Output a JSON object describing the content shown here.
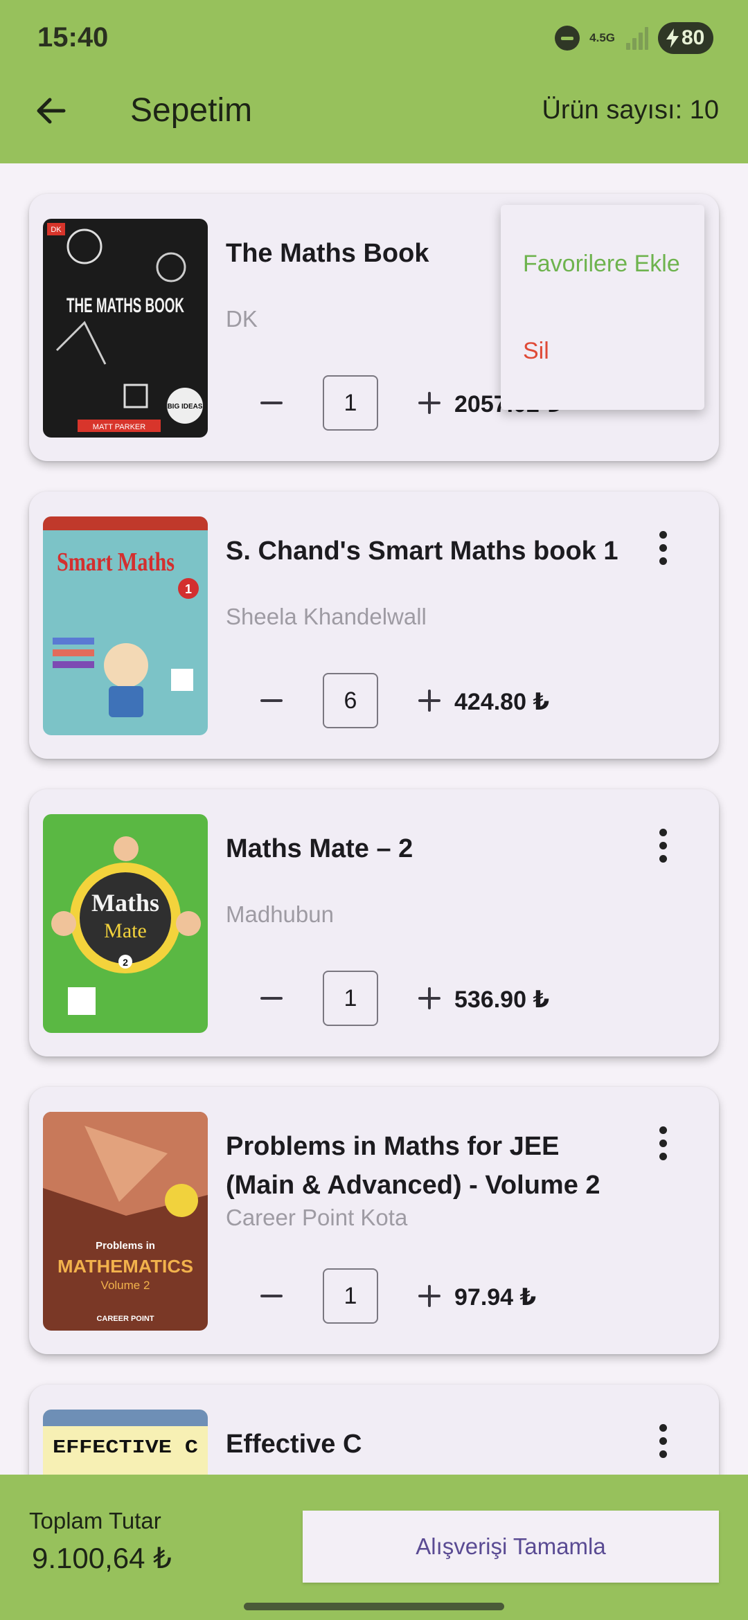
{
  "status_bar": {
    "time": "15:40",
    "network": "4.5G",
    "battery": "80"
  },
  "header": {
    "title": "Sepetim",
    "item_count": "Ürün sayısı: 10"
  },
  "items": [
    {
      "title": "The Maths Book",
      "author": "DK",
      "quantity": "1",
      "price": "2057.02 ₺",
      "cover_words": [
        "THE MATHS BOOK",
        "DK",
        "MATT PARKER",
        "BIG IDEAS"
      ]
    },
    {
      "title": "S. Chand's Smart Maths book 1",
      "author": "Sheela Khandelwall",
      "quantity": "6",
      "price": "424.80 ₺",
      "cover_words": [
        "Smart Maths",
        "1"
      ]
    },
    {
      "title": "Maths Mate – 2",
      "author": "Madhubun",
      "quantity": "1",
      "price": "536.90 ₺",
      "cover_words": [
        "Maths",
        "Mate",
        "2"
      ]
    },
    {
      "title": "Problems in Maths for JEE (Main & Advanced) - Volume 2",
      "author": "Career Point Kota",
      "quantity": "1",
      "price": "97.94 ₺",
      "cover_words": [
        "Problems in",
        "MATHEMATICS",
        "Volume 2",
        "CAREER POINT"
      ]
    },
    {
      "title": "Effective C",
      "author": "",
      "quantity": "",
      "price": "",
      "cover_words": [
        "EFFECTIVE C"
      ]
    }
  ],
  "popup_menu": {
    "add_favorite": "Favorilere Ekle",
    "delete": "Sil"
  },
  "footer": {
    "total_label": "Toplam Tutar",
    "total_value": "9.100,64 ₺",
    "checkout_label": "Alışverişi Tamamla"
  },
  "colors": {
    "app_bar": "#97c15c",
    "favorite": "#6eb34e",
    "delete": "#df4a37",
    "checkout_text": "#5a4b93"
  },
  "icons": [
    "back-arrow-icon",
    "do-not-disturb-icon",
    "signal-icon",
    "battery-icon",
    "minus-icon",
    "plus-icon",
    "more-vert-icon"
  ]
}
